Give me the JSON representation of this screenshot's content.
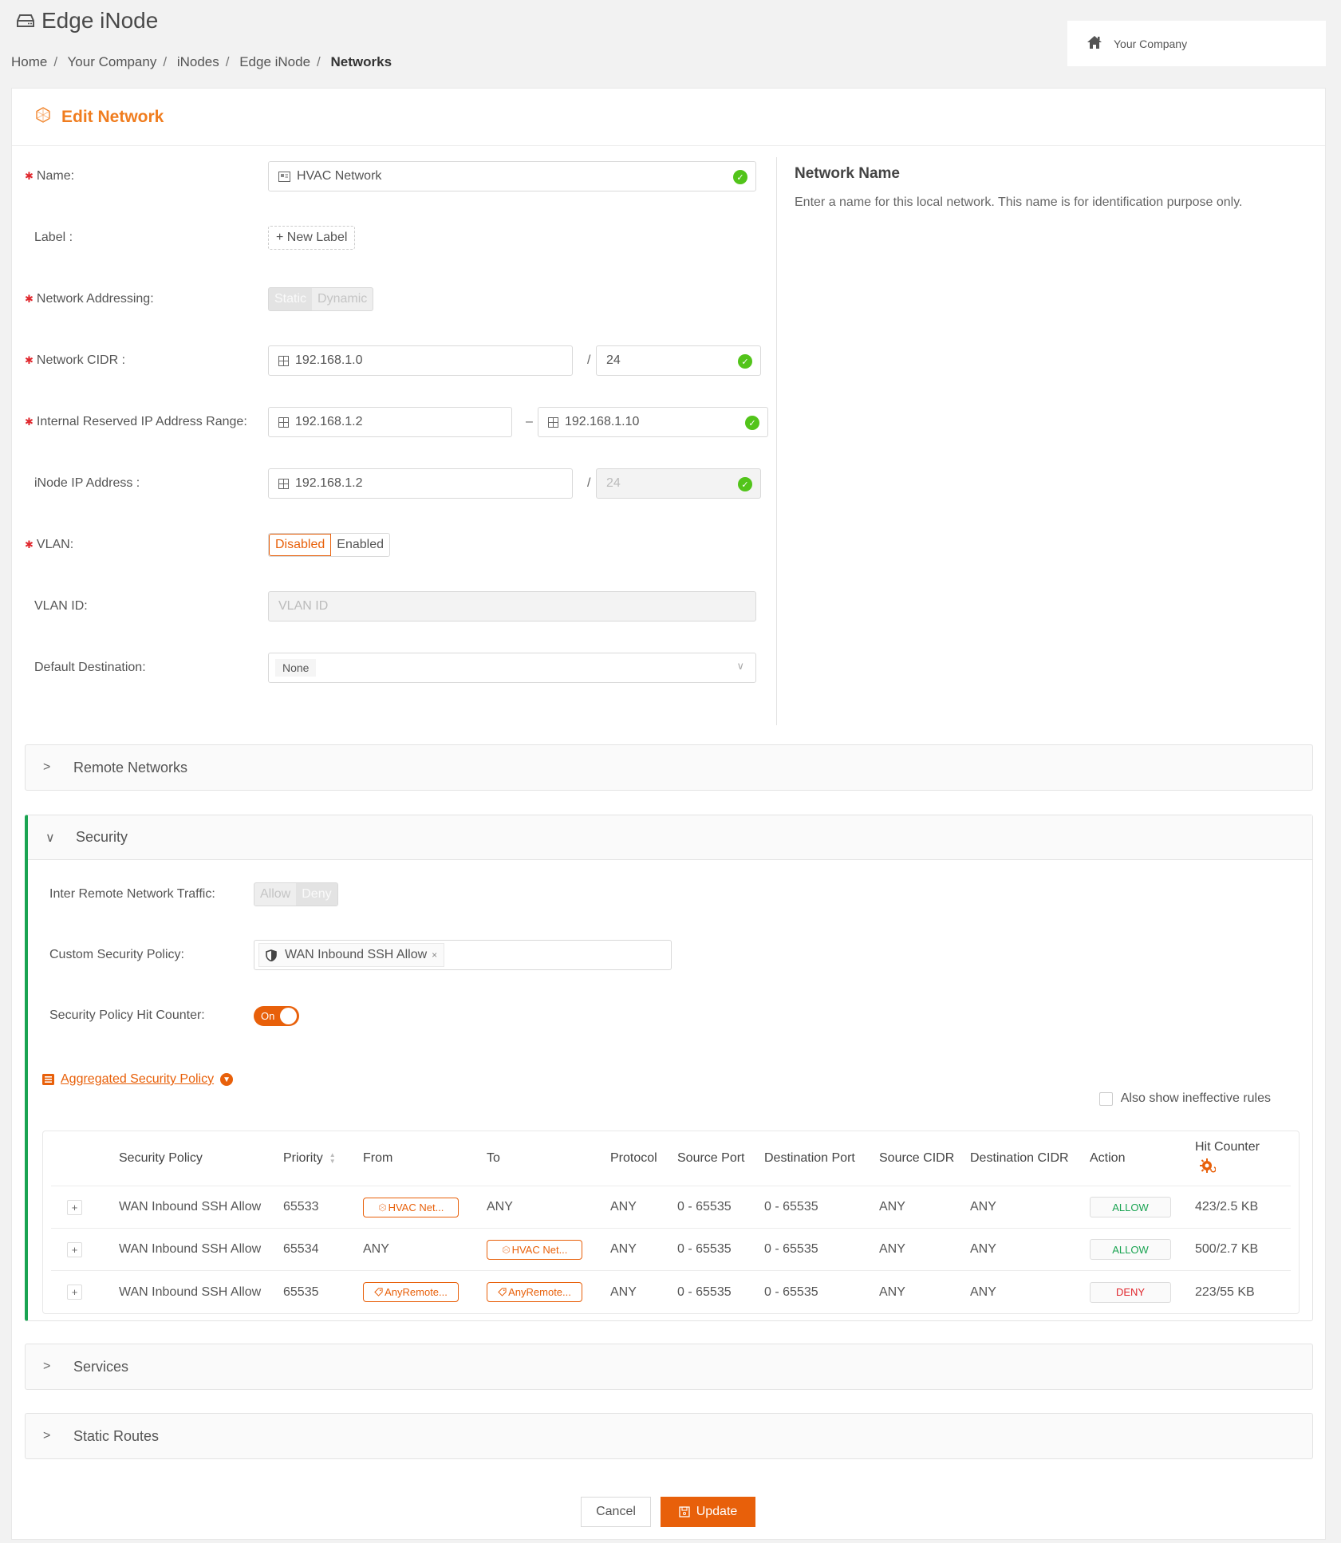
{
  "header": {
    "title": "Edge iNode",
    "breadcrumb": [
      "Home",
      "Your Company",
      "iNodes",
      "Edge iNode",
      "Networks"
    ],
    "company": "Your Company"
  },
  "card": {
    "title": "Edit Network"
  },
  "form": {
    "name": {
      "label": "Name:",
      "value": "HVAC Network"
    },
    "label": {
      "label": "Label :",
      "button": "+ New Label"
    },
    "addressing": {
      "label": "Network Addressing:",
      "options": [
        "Static",
        "Dynamic"
      ],
      "selected": "Static"
    },
    "cidr": {
      "label": "Network CIDR :",
      "ip": "192.168.1.0",
      "sep": "/",
      "prefix": "24"
    },
    "reserved": {
      "label": "Internal Reserved IP Address Range:",
      "start": "192.168.1.2",
      "sep": "–",
      "end": "192.168.1.10"
    },
    "inode_ip": {
      "label": "iNode IP Address :",
      "ip": "192.168.1.2",
      "sep": "/",
      "prefix": "24"
    },
    "vlan": {
      "label": "VLAN:",
      "options": [
        "Disabled",
        "Enabled"
      ],
      "selected": "Disabled"
    },
    "vlan_id": {
      "label": "VLAN ID:",
      "placeholder": "VLAN ID"
    },
    "default_dest": {
      "label": "Default Destination:",
      "value": "None"
    }
  },
  "help": {
    "title": "Network Name",
    "text": "Enter a name for this local network. This name is for identification purpose only."
  },
  "panels": {
    "remote": "Remote Networks",
    "security": "Security",
    "services": "Services",
    "static_routes": "Static Routes"
  },
  "security": {
    "inter_traffic": {
      "label": "Inter Remote Network Traffic:",
      "options": [
        "Allow",
        "Deny"
      ],
      "selected": "Deny"
    },
    "custom_policy": {
      "label": "Custom Security Policy:",
      "tag": "WAN Inbound SSH Allow",
      "remove": "×"
    },
    "hit_counter": {
      "label": "Security Policy Hit Counter:",
      "state": "On"
    },
    "aggregated_link": "Aggregated Security Policy",
    "ineffective": "Also show ineffective rules",
    "table": {
      "columns": [
        "Security Policy",
        "Priority",
        "From",
        "To",
        "Protocol",
        "Source Port",
        "Destination Port",
        "Source CIDR",
        "Destination CIDR",
        "Action",
        "Hit Counter"
      ],
      "rows": [
        {
          "policy": "WAN Inbound SSH Allow",
          "priority": "65533",
          "from": "HVAC Net...",
          "from_tag": "network",
          "to": "ANY",
          "to_tag": "",
          "protocol": "ANY",
          "src_port": "0 - 65535",
          "dst_port": "0 - 65535",
          "src_cidr": "ANY",
          "dst_cidr": "ANY",
          "action": "ALLOW",
          "hits": "423/2.5 KB"
        },
        {
          "policy": "WAN Inbound SSH Allow",
          "priority": "65534",
          "from": "ANY",
          "from_tag": "",
          "to": "HVAC Net...",
          "to_tag": "network",
          "protocol": "ANY",
          "src_port": "0 - 65535",
          "dst_port": "0 - 65535",
          "src_cidr": "ANY",
          "dst_cidr": "ANY",
          "action": "ALLOW",
          "hits": "500/2.7 KB"
        },
        {
          "policy": "WAN Inbound SSH Allow",
          "priority": "65535",
          "from": "AnyRemote...",
          "from_tag": "label",
          "to": "AnyRemote...",
          "to_tag": "label",
          "protocol": "ANY",
          "src_port": "0 - 65535",
          "dst_port": "0 - 65535",
          "src_cidr": "ANY",
          "dst_cidr": "ANY",
          "action": "DENY",
          "hits": "223/55 KB"
        }
      ]
    }
  },
  "buttons": {
    "cancel": "Cancel",
    "update": "Update"
  },
  "colors": {
    "accent": "#e8600a",
    "success": "#52c41a",
    "allow": "#1aa452",
    "deny": "#e0282e"
  }
}
